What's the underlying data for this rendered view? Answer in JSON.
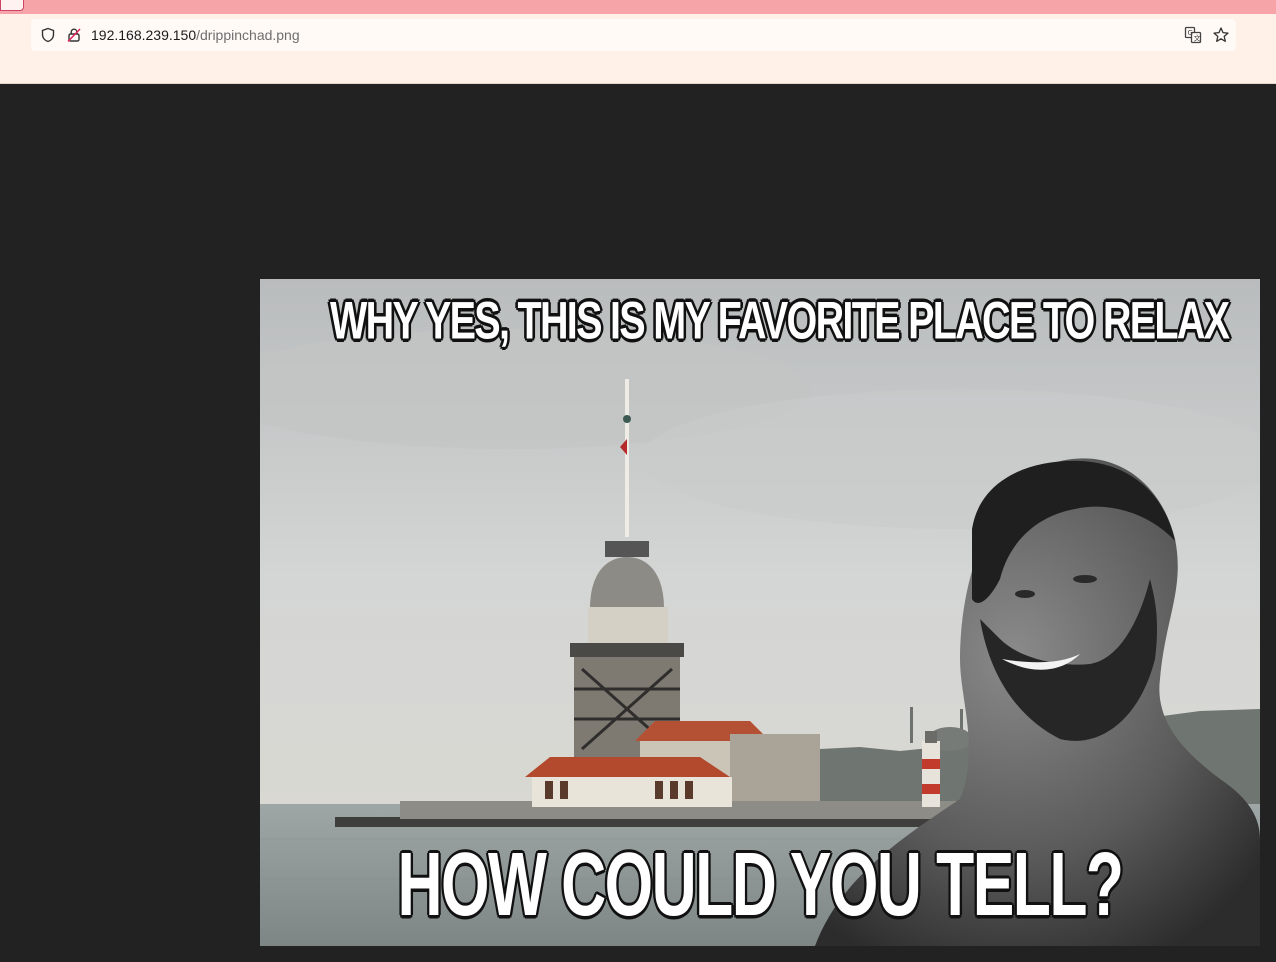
{
  "browser": {
    "url_host": "192.168.239.150",
    "url_path": "/drippinchad.png",
    "icons": {
      "tracking_protection": "shield-icon",
      "connection": "insecure-lock-icon",
      "translate": "translate-icon",
      "bookmark": "star-icon"
    }
  },
  "meme": {
    "top_text": "WHY YES, THIS IS MY FAVORITE PLACE TO RELAX",
    "bottom_text": "HOW COULD YOU TELL?"
  },
  "colors": {
    "tab_strip": "#f6a4a8",
    "toolbar": "#fff0e8",
    "viewer_background": "#222222"
  }
}
